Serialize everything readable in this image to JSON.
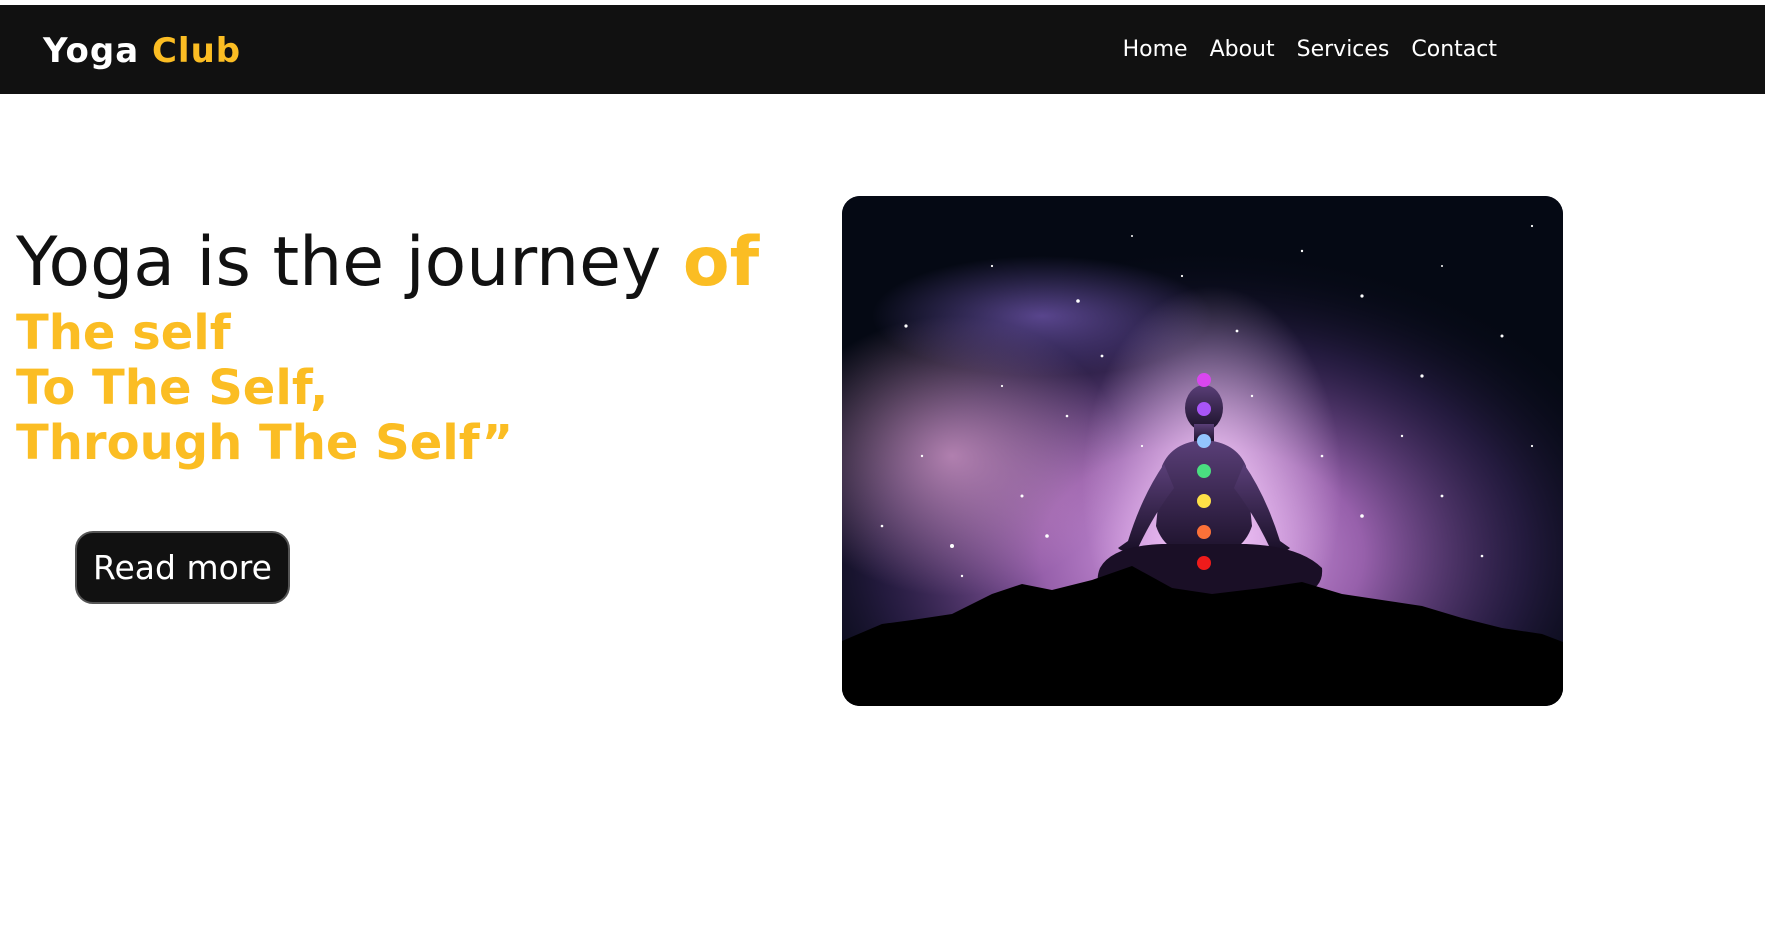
{
  "brand": {
    "name": "Yoga",
    "accent": "Club"
  },
  "nav": {
    "items": [
      "Home",
      "About",
      "Services",
      "Contact"
    ]
  },
  "hero": {
    "headline": "Yoga is the journey",
    "headline_accent": "of",
    "lines": [
      "The self",
      "To The Self,",
      "Through The Self”"
    ],
    "button_label": "Read more",
    "image_subject": "meditating-figure-silhouette-with-chakra-dots"
  },
  "colors": {
    "accent": "#fbbd23",
    "nav_background": "#111111",
    "text": "#111111",
    "chakras": [
      "#d946ef",
      "#a855f7",
      "#93c5fd",
      "#4ade80",
      "#fde047",
      "#fb7138",
      "#ef1b1b"
    ]
  }
}
